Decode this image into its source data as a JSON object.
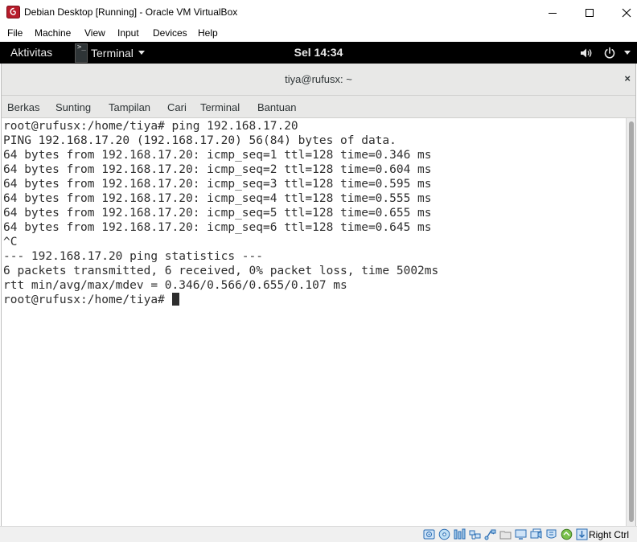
{
  "window": {
    "title": "Debian Desktop [Running] - Oracle VM VirtualBox",
    "app_icon": "virtualbox-debian-icon",
    "controls": [
      "minimize-icon",
      "maximize-icon",
      "close-icon"
    ]
  },
  "vb_menu": {
    "items": [
      {
        "label": "File"
      },
      {
        "label": "Machine"
      },
      {
        "label": "View"
      },
      {
        "label": "Input"
      },
      {
        "label": "Devices"
      },
      {
        "label": "Help"
      }
    ]
  },
  "gnome": {
    "activities": "Aktivitas",
    "app_name": "Terminal",
    "app_icon_glyph": ">_",
    "clock": "Sel 14:34",
    "status_icons": [
      "volume-icon",
      "power-icon",
      "caret-down-icon"
    ]
  },
  "terminal": {
    "title": "tiya@rufusx: ~",
    "close_glyph": "×",
    "menu": [
      {
        "label": "Berkas"
      },
      {
        "label": "Sunting"
      },
      {
        "label": "Tampilan"
      },
      {
        "label": "Cari"
      },
      {
        "label": "Terminal"
      },
      {
        "label": "Bantuan"
      }
    ],
    "lines": [
      "root@rufusx:/home/tiya# ping 192.168.17.20",
      "PING 192.168.17.20 (192.168.17.20) 56(84) bytes of data.",
      "64 bytes from 192.168.17.20: icmp_seq=1 ttl=128 time=0.346 ms",
      "64 bytes from 192.168.17.20: icmp_seq=2 ttl=128 time=0.604 ms",
      "64 bytes from 192.168.17.20: icmp_seq=3 ttl=128 time=0.595 ms",
      "64 bytes from 192.168.17.20: icmp_seq=4 ttl=128 time=0.555 ms",
      "64 bytes from 192.168.17.20: icmp_seq=5 ttl=128 time=0.655 ms",
      "64 bytes from 192.168.17.20: icmp_seq=6 ttl=128 time=0.645 ms",
      "^C",
      "--- 192.168.17.20 ping statistics ---",
      "6 packets transmitted, 6 received, 0% packet loss, time 5002ms",
      "rtt min/avg/max/mdev = 0.346/0.566/0.655/0.107 ms"
    ],
    "prompt": "root@rufusx:/home/tiya# "
  },
  "vb_status": {
    "icons": [
      "hard-disk-icon",
      "optical-disk-icon",
      "audio-icon",
      "network-icon",
      "usb-icon",
      "shared-folders-icon",
      "display-icon",
      "video-capture-icon",
      "recording-icon",
      "cpu-icon",
      "mouse-integration-icon",
      "keyboard-capture-icon"
    ],
    "host_key": "Right Ctrl"
  }
}
